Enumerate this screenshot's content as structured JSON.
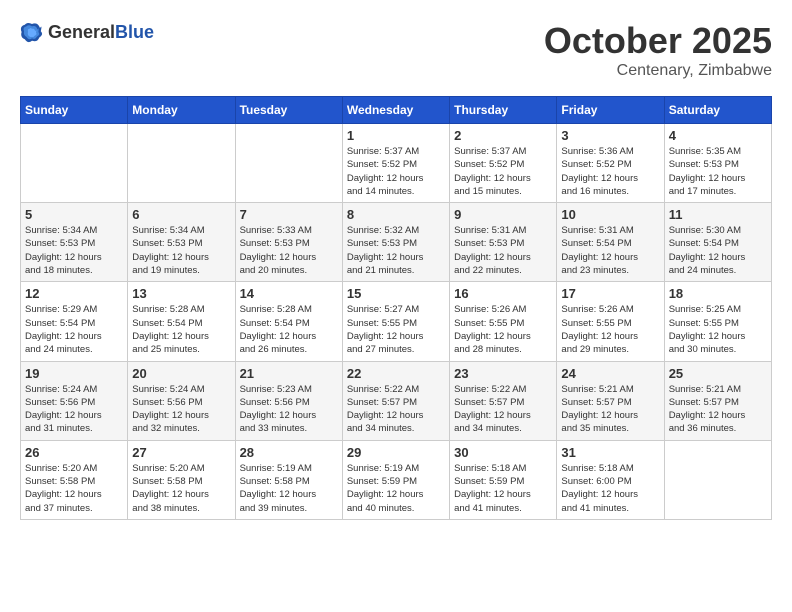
{
  "header": {
    "logo_general": "General",
    "logo_blue": "Blue",
    "month": "October 2025",
    "location": "Centenary, Zimbabwe"
  },
  "days_of_week": [
    "Sunday",
    "Monday",
    "Tuesday",
    "Wednesday",
    "Thursday",
    "Friday",
    "Saturday"
  ],
  "weeks": [
    [
      {
        "day": "",
        "info": ""
      },
      {
        "day": "",
        "info": ""
      },
      {
        "day": "",
        "info": ""
      },
      {
        "day": "1",
        "info": "Sunrise: 5:37 AM\nSunset: 5:52 PM\nDaylight: 12 hours\nand 14 minutes."
      },
      {
        "day": "2",
        "info": "Sunrise: 5:37 AM\nSunset: 5:52 PM\nDaylight: 12 hours\nand 15 minutes."
      },
      {
        "day": "3",
        "info": "Sunrise: 5:36 AM\nSunset: 5:52 PM\nDaylight: 12 hours\nand 16 minutes."
      },
      {
        "day": "4",
        "info": "Sunrise: 5:35 AM\nSunset: 5:53 PM\nDaylight: 12 hours\nand 17 minutes."
      }
    ],
    [
      {
        "day": "5",
        "info": "Sunrise: 5:34 AM\nSunset: 5:53 PM\nDaylight: 12 hours\nand 18 minutes."
      },
      {
        "day": "6",
        "info": "Sunrise: 5:34 AM\nSunset: 5:53 PM\nDaylight: 12 hours\nand 19 minutes."
      },
      {
        "day": "7",
        "info": "Sunrise: 5:33 AM\nSunset: 5:53 PM\nDaylight: 12 hours\nand 20 minutes."
      },
      {
        "day": "8",
        "info": "Sunrise: 5:32 AM\nSunset: 5:53 PM\nDaylight: 12 hours\nand 21 minutes."
      },
      {
        "day": "9",
        "info": "Sunrise: 5:31 AM\nSunset: 5:53 PM\nDaylight: 12 hours\nand 22 minutes."
      },
      {
        "day": "10",
        "info": "Sunrise: 5:31 AM\nSunset: 5:54 PM\nDaylight: 12 hours\nand 23 minutes."
      },
      {
        "day": "11",
        "info": "Sunrise: 5:30 AM\nSunset: 5:54 PM\nDaylight: 12 hours\nand 24 minutes."
      }
    ],
    [
      {
        "day": "12",
        "info": "Sunrise: 5:29 AM\nSunset: 5:54 PM\nDaylight: 12 hours\nand 24 minutes."
      },
      {
        "day": "13",
        "info": "Sunrise: 5:28 AM\nSunset: 5:54 PM\nDaylight: 12 hours\nand 25 minutes."
      },
      {
        "day": "14",
        "info": "Sunrise: 5:28 AM\nSunset: 5:54 PM\nDaylight: 12 hours\nand 26 minutes."
      },
      {
        "day": "15",
        "info": "Sunrise: 5:27 AM\nSunset: 5:55 PM\nDaylight: 12 hours\nand 27 minutes."
      },
      {
        "day": "16",
        "info": "Sunrise: 5:26 AM\nSunset: 5:55 PM\nDaylight: 12 hours\nand 28 minutes."
      },
      {
        "day": "17",
        "info": "Sunrise: 5:26 AM\nSunset: 5:55 PM\nDaylight: 12 hours\nand 29 minutes."
      },
      {
        "day": "18",
        "info": "Sunrise: 5:25 AM\nSunset: 5:55 PM\nDaylight: 12 hours\nand 30 minutes."
      }
    ],
    [
      {
        "day": "19",
        "info": "Sunrise: 5:24 AM\nSunset: 5:56 PM\nDaylight: 12 hours\nand 31 minutes."
      },
      {
        "day": "20",
        "info": "Sunrise: 5:24 AM\nSunset: 5:56 PM\nDaylight: 12 hours\nand 32 minutes."
      },
      {
        "day": "21",
        "info": "Sunrise: 5:23 AM\nSunset: 5:56 PM\nDaylight: 12 hours\nand 33 minutes."
      },
      {
        "day": "22",
        "info": "Sunrise: 5:22 AM\nSunset: 5:57 PM\nDaylight: 12 hours\nand 34 minutes."
      },
      {
        "day": "23",
        "info": "Sunrise: 5:22 AM\nSunset: 5:57 PM\nDaylight: 12 hours\nand 34 minutes."
      },
      {
        "day": "24",
        "info": "Sunrise: 5:21 AM\nSunset: 5:57 PM\nDaylight: 12 hours\nand 35 minutes."
      },
      {
        "day": "25",
        "info": "Sunrise: 5:21 AM\nSunset: 5:57 PM\nDaylight: 12 hours\nand 36 minutes."
      }
    ],
    [
      {
        "day": "26",
        "info": "Sunrise: 5:20 AM\nSunset: 5:58 PM\nDaylight: 12 hours\nand 37 minutes."
      },
      {
        "day": "27",
        "info": "Sunrise: 5:20 AM\nSunset: 5:58 PM\nDaylight: 12 hours\nand 38 minutes."
      },
      {
        "day": "28",
        "info": "Sunrise: 5:19 AM\nSunset: 5:58 PM\nDaylight: 12 hours\nand 39 minutes."
      },
      {
        "day": "29",
        "info": "Sunrise: 5:19 AM\nSunset: 5:59 PM\nDaylight: 12 hours\nand 40 minutes."
      },
      {
        "day": "30",
        "info": "Sunrise: 5:18 AM\nSunset: 5:59 PM\nDaylight: 12 hours\nand 41 minutes."
      },
      {
        "day": "31",
        "info": "Sunrise: 5:18 AM\nSunset: 6:00 PM\nDaylight: 12 hours\nand 41 minutes."
      },
      {
        "day": "",
        "info": ""
      }
    ]
  ]
}
